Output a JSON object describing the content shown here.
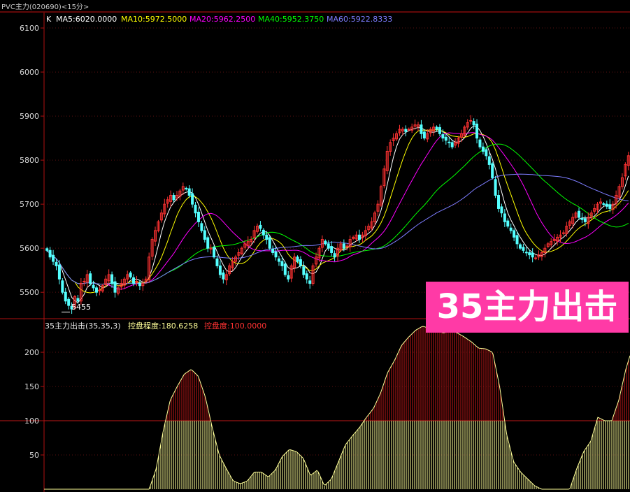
{
  "title_bar": "PVC主力(020690)<15分>",
  "banner_text": "35主力出击",
  "chart_data": [
    {
      "type": "candlestick",
      "indicator_label": "K",
      "ma_legend": [
        {
          "label": "MA5:6020.0000",
          "color": "#ffffff"
        },
        {
          "label": "MA10:5972.5000",
          "color": "#ffff00"
        },
        {
          "label": "MA20:5962.2500",
          "color": "#ff00ff"
        },
        {
          "label": "MA40:5952.3750",
          "color": "#00ff00"
        },
        {
          "label": "MA60:5922.8333",
          "color": "#7d7dff"
        }
      ],
      "y_ticks": [
        "6100",
        "6000",
        "5900",
        "5800",
        "5700",
        "5600",
        "5500"
      ],
      "ylim": [
        5440,
        6135
      ],
      "low_marker": "5455",
      "up_color": "#ff3232",
      "down_color": "#54ffff",
      "close_series": [
        5595,
        5580,
        5570,
        5560,
        5530,
        5500,
        5480,
        5470,
        5462,
        5490,
        5480,
        5520,
        5525,
        5540,
        5520,
        5510,
        5500,
        5505,
        5515,
        5530,
        5540,
        5520,
        5500,
        5510,
        5520,
        5530,
        5540,
        5535,
        5520,
        5525,
        5515,
        5520,
        5530,
        5580,
        5620,
        5640,
        5660,
        5680,
        5700,
        5710,
        5720,
        5710,
        5720,
        5730,
        5740,
        5735,
        5720,
        5700,
        5680,
        5660,
        5640,
        5620,
        5600,
        5600,
        5580,
        5560,
        5540,
        5530,
        5540,
        5560,
        5570,
        5580,
        5590,
        5600,
        5610,
        5615,
        5620,
        5640,
        5650,
        5645,
        5630,
        5620,
        5600,
        5590,
        5580,
        5570,
        5560,
        5540,
        5530,
        5560,
        5580,
        5570,
        5560,
        5540,
        5530,
        5520,
        5560,
        5580,
        5600,
        5620,
        5610,
        5600,
        5590,
        5580,
        5600,
        5610,
        5600,
        5605,
        5620,
        5625,
        5630,
        5620,
        5630,
        5640,
        5650,
        5660,
        5680,
        5700,
        5740,
        5780,
        5820,
        5840,
        5850,
        5860,
        5870,
        5870,
        5865,
        5870,
        5875,
        5880,
        5880,
        5860,
        5850,
        5860,
        5870,
        5875,
        5870,
        5860,
        5850,
        5845,
        5840,
        5830,
        5840,
        5850,
        5860,
        5875,
        5885,
        5890,
        5880,
        5850,
        5830,
        5820,
        5810,
        5790,
        5760,
        5720,
        5690,
        5680,
        5660,
        5650,
        5640,
        5625,
        5610,
        5600,
        5595,
        5590,
        5585,
        5580,
        5578,
        5585,
        5590,
        5600,
        5610,
        5615,
        5620,
        5625,
        5630,
        5635,
        5650,
        5660,
        5670,
        5680,
        5670,
        5665,
        5660,
        5670,
        5680,
        5690,
        5700,
        5705,
        5700,
        5695,
        5690,
        5700,
        5720,
        5740,
        5760,
        5790,
        5810
      ]
    },
    {
      "type": "area",
      "label_title": "35主力出击(35,35,3)",
      "label_level": "控盘程度:180.6258",
      "label_pct": "控盘度:100.0000",
      "y_ticks": [
        "200",
        "150",
        "100",
        "50"
      ],
      "ylim": [
        0,
        248
      ],
      "threshold": 100,
      "below_color": "#ffff99",
      "above_color": "#c01818",
      "x": [
        0,
        40,
        50,
        60,
        70,
        80,
        90,
        100,
        110,
        120,
        130,
        140,
        150,
        160,
        170,
        180,
        190,
        200,
        210,
        220,
        230,
        240,
        250,
        260,
        270,
        280,
        290,
        300,
        310,
        320,
        330,
        340,
        350,
        360,
        370,
        380,
        390,
        400,
        410,
        420,
        430,
        440,
        450,
        460,
        470,
        480,
        490,
        500,
        510,
        520,
        530,
        540,
        550,
        560,
        570,
        580,
        590,
        600,
        610,
        620,
        630,
        640,
        650,
        660,
        670,
        680,
        690,
        700,
        710,
        720,
        730,
        740,
        745,
        750,
        760,
        770,
        780,
        790,
        800,
        810,
        820,
        830,
        836
      ],
      "values": [
        0,
        0,
        0,
        0,
        0,
        0,
        0,
        0,
        0,
        0,
        0,
        0,
        0,
        30,
        85,
        130,
        150,
        168,
        175,
        165,
        135,
        90,
        50,
        30,
        12,
        8,
        12,
        25,
        25,
        18,
        28,
        48,
        58,
        55,
        45,
        20,
        28,
        5,
        15,
        40,
        65,
        78,
        90,
        105,
        118,
        140,
        170,
        188,
        210,
        222,
        232,
        238,
        235,
        232,
        228,
        232,
        228,
        222,
        215,
        206,
        205,
        200,
        150,
        80,
        40,
        25,
        15,
        5,
        0,
        0,
        0,
        0,
        0,
        0,
        30,
        55,
        70,
        105,
        100,
        100,
        130,
        175,
        195
      ]
    }
  ]
}
